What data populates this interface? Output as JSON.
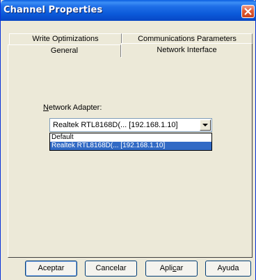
{
  "window": {
    "title": "Channel Properties"
  },
  "tabs": {
    "row1": [
      "Write Optimizations",
      "Communications Parameters"
    ],
    "row2": [
      "General",
      "Network Interface"
    ],
    "active": "Network Interface"
  },
  "network": {
    "label_prefix": "N",
    "label_rest": "etwork Adapter:",
    "selected_value": "Realtek RTL8168D(... [192.168.1.10]",
    "options": [
      "Default",
      "Realtek RTL8168D(... [192.168.1.10]"
    ],
    "highlighted_option": "Realtek RTL8168D(... [192.168.1.10]"
  },
  "buttons": {
    "ok": "Aceptar",
    "cancel": "Cancelar",
    "apply_pre": "Apli",
    "apply_u": "c",
    "apply_post": "ar",
    "help": "Ayuda"
  },
  "colors": {
    "title_bar": "#0a58d8",
    "selection": "#316ac5",
    "dialog_bg": "#ece9d8"
  },
  "icons": {
    "close": "close-icon",
    "dropdown": "chevron-down-icon"
  }
}
